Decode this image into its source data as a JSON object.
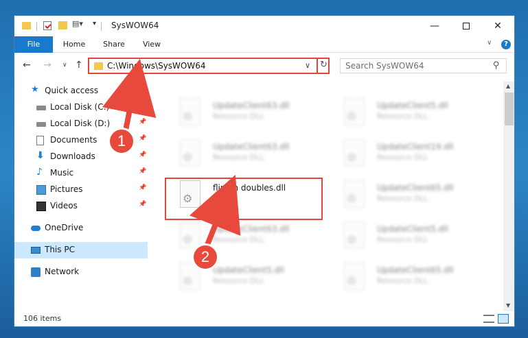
{
  "window": {
    "title": "SysWOW64",
    "buttons": {
      "minimize": "—",
      "close": "✕"
    }
  },
  "quick_access_toolbar": {
    "dropdown": "▾",
    "customize": "▤▾"
  },
  "ribbon": {
    "tabs": [
      "File",
      "Home",
      "Share",
      "View"
    ],
    "expand": "∨",
    "help": "?"
  },
  "address_bar": {
    "path": "C:\\Windows\\SysWOW64",
    "dropdown": "∨",
    "refresh": "↻"
  },
  "navigation": {
    "back": "←",
    "forward": "→",
    "recent": "∨",
    "up": "↑"
  },
  "search": {
    "placeholder": "Search SysWOW64",
    "icon": "⚲"
  },
  "sidebar": {
    "pin_glyph": "📌",
    "items": [
      {
        "label": "Quick access",
        "icon": "star-icon",
        "glyph": "★",
        "pinned": false,
        "selected": false
      },
      {
        "label": "Local Disk (C:)",
        "icon": "local-disk-icon",
        "pinned": true,
        "selected": false
      },
      {
        "label": "Local Disk (D:)",
        "icon": "local-disk-icon",
        "pinned": true,
        "selected": false
      },
      {
        "label": "Documents",
        "icon": "documents-icon",
        "pinned": true,
        "selected": false
      },
      {
        "label": "Downloads",
        "icon": "downloads-icon",
        "glyph": "⬇",
        "pinned": true,
        "selected": false
      },
      {
        "label": "Music",
        "icon": "music-icon",
        "glyph": "♪",
        "pinned": true,
        "selected": false
      },
      {
        "label": "Pictures",
        "icon": "pictures-icon",
        "pinned": true,
        "selected": false
      },
      {
        "label": "Videos",
        "icon": "videos-icon",
        "pinned": true,
        "selected": false
      },
      {
        "label": "OneDrive",
        "icon": "onedrive-icon",
        "pinned": false,
        "selected": false
      },
      {
        "label": "This PC",
        "icon": "this-pc-icon",
        "pinned": false,
        "selected": true
      },
      {
        "label": "Network",
        "icon": "network-icon",
        "pinned": false,
        "selected": false
      }
    ]
  },
  "files": [
    {
      "name": "UpdateClient63.dll",
      "type": "Resource DLL",
      "blurred": true
    },
    {
      "name": "UpdateClient5.dll",
      "type": "Resource DLL",
      "blurred": true
    },
    {
      "name": "UpdateClient63.dll",
      "type": "Resource DLL",
      "blurred": true
    },
    {
      "name": "UpdateClient19.dll",
      "type": "Resource DLL",
      "blurred": true
    },
    {
      "name": "flippin doubles.dll",
      "type": "",
      "blurred": false,
      "highlighted": true
    },
    {
      "name": "UpdateClient65.dll",
      "type": "Resource DLL",
      "blurred": true
    },
    {
      "name": "UpdateClient63.dll",
      "type": "Resource DLL",
      "blurred": true
    },
    {
      "name": "UpdateClient5.dll",
      "type": "Resource DLL",
      "blurred": true
    },
    {
      "name": "UpdateClient5.dll",
      "type": "Resource DLL",
      "blurred": true
    },
    {
      "name": "UpdateClient65.dll",
      "type": "Resource DLL",
      "blurred": true
    }
  ],
  "scrollbar": {
    "up": "▲",
    "down": "▼"
  },
  "status": {
    "item_count": "106 items"
  },
  "annotations": {
    "badges": [
      "1",
      "2"
    ],
    "color": "#e74a3d"
  }
}
